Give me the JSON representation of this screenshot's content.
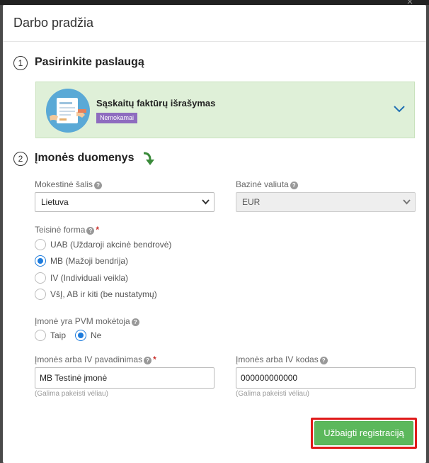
{
  "modal": {
    "title": "Darbo pradžia",
    "close_glyph": "×"
  },
  "step1": {
    "number": "1",
    "title": "Pasirinkite paslaugą"
  },
  "service": {
    "name": "Sąskaitų faktūrų išrašymas",
    "badge": "Nemokamai",
    "icon": "invoice-illustration",
    "expand_icon": "chevron-down-icon"
  },
  "step2": {
    "number": "2",
    "title": "Įmonės duomenys",
    "arrow_icon": "arrow-down-icon"
  },
  "fields": {
    "tax_country": {
      "label": "Mokestinė šalis",
      "value": "Lietuva"
    },
    "base_currency": {
      "label": "Bazinė valiuta",
      "value": "EUR",
      "disabled": true
    },
    "legal_form": {
      "label": "Teisinė forma",
      "required_mark": "*",
      "options": [
        {
          "label": "UAB (Uždaroji akcinė bendrovė)",
          "checked": false
        },
        {
          "label": "MB (Mažoji bendrija)",
          "checked": true
        },
        {
          "label": "IV (Individuali veikla)",
          "checked": false
        },
        {
          "label": "VšĮ, AB ir kiti (be nustatymų)",
          "checked": false
        }
      ]
    },
    "vat_payer": {
      "label": "Įmonė yra PVM mokėtoja",
      "options": [
        {
          "label": "Taip",
          "checked": false
        },
        {
          "label": "Ne",
          "checked": true
        }
      ]
    },
    "company_name": {
      "label": "Įmonės arba IV pavadinimas",
      "required_mark": "*",
      "value": "MB Testinė įmonė",
      "hint": "(Galima pakeisti vėliau)"
    },
    "company_code": {
      "label": "Įmonės arba IV kodas",
      "value": "000000000000",
      "hint": "(Galima pakeisti vėliau)"
    }
  },
  "help_glyph": "?",
  "submit": {
    "label": "Užbaigti registraciją"
  },
  "colors": {
    "accent_green": "#5cb85c",
    "card_bg": "#dff0d8",
    "badge": "#8e6cbf",
    "radio_checked": "#1d7bdc",
    "highlight_frame": "#e01b1b"
  }
}
